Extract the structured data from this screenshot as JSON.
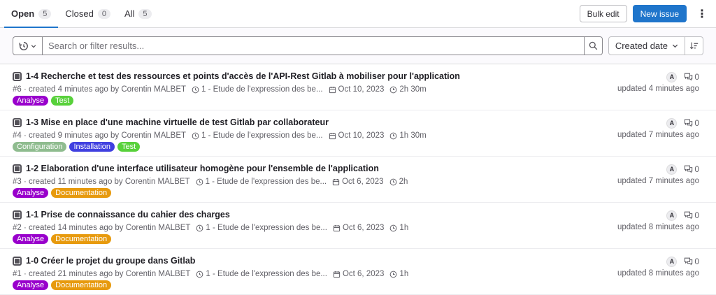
{
  "tabs": [
    {
      "label": "Open",
      "count": "5"
    },
    {
      "label": "Closed",
      "count": "0"
    },
    {
      "label": "All",
      "count": "5"
    }
  ],
  "actions": {
    "bulk_edit": "Bulk edit",
    "new_issue": "New issue",
    "more": "⋮"
  },
  "filter": {
    "placeholder": "Search or filter results...",
    "sort_label": "Created date"
  },
  "colors": {
    "accent": "#1f75cb",
    "label_analyse": "#9900cc",
    "label_test": "#58d13b",
    "label_documentation": "#e79a0e",
    "label_configuration": "#8fbc8f",
    "label_installation": "#4040e0"
  },
  "issues": [
    {
      "title": "1-4 Recherche et test des ressources et points d'accès de l'API-Rest Gitlab à mobiliser pour l'application",
      "ref": "#6 · created 4 minutes ago by Corentin MALBET",
      "milestone": "1 - Etude de l'expression des be...",
      "due": "Oct 10, 2023",
      "time": "2h 30m",
      "labels": [
        "Analyse",
        "Test"
      ],
      "assignee": "A",
      "comments": "0",
      "updated": "updated 4 minutes ago"
    },
    {
      "title": "1-3 Mise en place d'une machine virtuelle de test Gitlab par collaborateur",
      "ref": "#4 · created 9 minutes ago by Corentin MALBET",
      "milestone": "1 - Etude de l'expression des be...",
      "due": "Oct 10, 2023",
      "time": "1h 30m",
      "labels": [
        "Configuration",
        "Installation",
        "Test"
      ],
      "assignee": "A",
      "comments": "0",
      "updated": "updated 7 minutes ago"
    },
    {
      "title": "1-2 Elaboration d'une interface utilisateur homogène pour l'ensemble de l'application",
      "ref": "#3 · created 11 minutes ago by Corentin MALBET",
      "milestone": "1 - Etude de l'expression des be...",
      "due": "Oct 6, 2023",
      "time": "2h",
      "labels": [
        "Analyse",
        "Documentation"
      ],
      "assignee": "A",
      "comments": "0",
      "updated": "updated 7 minutes ago"
    },
    {
      "title": "1-1 Prise de connaissance du cahier des charges",
      "ref": "#2 · created 14 minutes ago by Corentin MALBET",
      "milestone": "1 - Etude de l'expression des be...",
      "due": "Oct 6, 2023",
      "time": "1h",
      "labels": [
        "Analyse",
        "Documentation"
      ],
      "assignee": "A",
      "comments": "0",
      "updated": "updated 8 minutes ago"
    },
    {
      "title": "1-0 Créer le projet du groupe dans Gitlab",
      "ref": "#1 · created 21 minutes ago by Corentin MALBET",
      "milestone": "1 - Etude de l'expression des be...",
      "due": "Oct 6, 2023",
      "time": "1h",
      "labels": [
        "Analyse",
        "Documentation"
      ],
      "assignee": "A",
      "comments": "0",
      "updated": "updated 8 minutes ago"
    }
  ]
}
